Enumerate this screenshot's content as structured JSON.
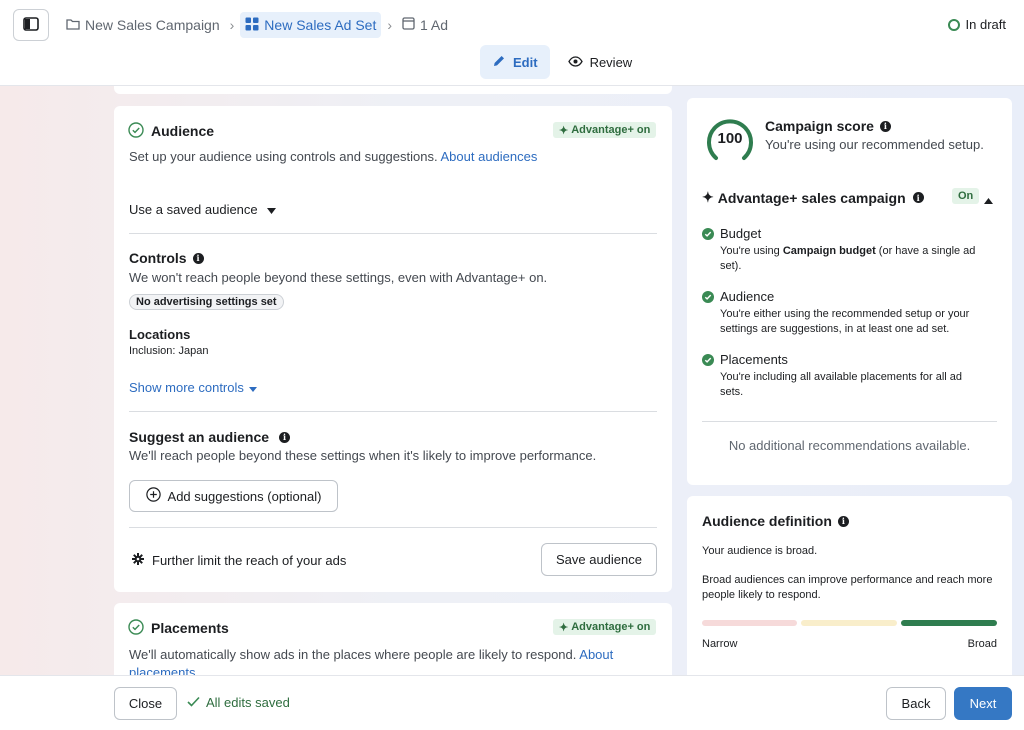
{
  "breadcrumb": {
    "campaign": "New Sales Campaign",
    "adset": "New Sales Ad Set",
    "ad": "1 Ad"
  },
  "status": "In draft",
  "modes": {
    "edit": "Edit",
    "review": "Review"
  },
  "audience": {
    "title": "Audience",
    "badge": "Advantage+ on",
    "description": "Set up your audience using controls and suggestions.",
    "about_link": "About audiences",
    "saved_audience": "Use a saved audience",
    "controls_title": "Controls",
    "controls_desc": "We won't reach people beyond these settings, even with Advantage+ on.",
    "controls_pill": "No advertising settings set",
    "locations_title": "Locations",
    "locations_value": "Inclusion: Japan",
    "show_more": "Show more controls",
    "suggest_title": "Suggest an audience",
    "suggest_desc": "We'll reach people beyond these settings when it's likely to improve performance.",
    "add_suggestions": "Add suggestions (optional)",
    "further_limit": "Further limit the reach of your ads",
    "save_audience": "Save audience"
  },
  "placements": {
    "title": "Placements",
    "badge": "Advantage+ on",
    "description": "We'll automatically show ads in the places where people are likely to respond.",
    "about_link_1": "About",
    "about_link_2": "placements"
  },
  "score": {
    "value": "100",
    "value_fraction": 1.0,
    "title": "Campaign score",
    "subtitle": "You're using our recommended setup.",
    "section_title": "Advantage+ sales campaign",
    "section_toggle": "On",
    "items": [
      {
        "title": "Budget",
        "desc_before": "You're using ",
        "desc_bold": "Campaign budget",
        "desc_after_1": " (or have a single ad",
        "desc_after_2": "set)."
      },
      {
        "title": "Audience",
        "desc_1": "You're either using the recommended setup or your",
        "desc_2": "settings are suggestions, in at least one ad set."
      },
      {
        "title": "Placements",
        "desc_1": "You're including all available placements for all ad",
        "desc_2": "sets."
      }
    ],
    "no_more": "No additional recommendations available."
  },
  "definition": {
    "title": "Audience definition",
    "summary": "Your audience is broad.",
    "explain_1": "Broad audiences can improve performance and reach more",
    "explain_2": "people likely to respond.",
    "scale_min": "Narrow",
    "scale_max": "Broad",
    "level": "broad"
  },
  "footer": {
    "close": "Close",
    "saved": "All edits saved",
    "back": "Back",
    "next": "Next"
  },
  "colors": {
    "accent": "#3578c4",
    "success": "#3a8a54",
    "scale_narrow": "#f6dada",
    "scale_mid": "#f9eecb",
    "scale_broad": "#2f7d4f"
  }
}
